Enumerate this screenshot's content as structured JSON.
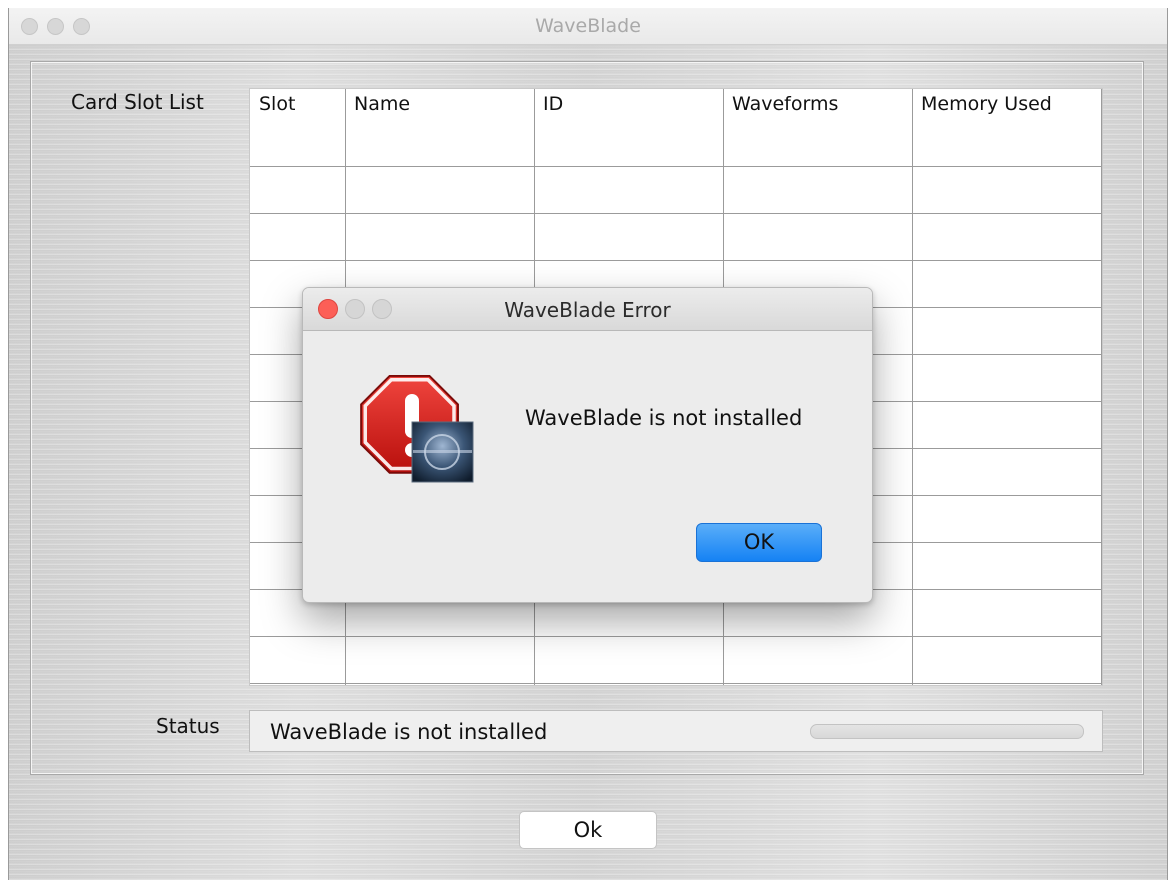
{
  "window": {
    "title": "WaveBlade"
  },
  "labels": {
    "card_slot_list": "Card Slot List",
    "status": "Status"
  },
  "table": {
    "columns": [
      "Slot",
      "Name",
      "ID",
      "Waveforms",
      "Memory Used"
    ],
    "rows": []
  },
  "status": {
    "text": "WaveBlade is not installed"
  },
  "buttons": {
    "ok": "Ok"
  },
  "dialog": {
    "title": "WaveBlade Error",
    "message": "WaveBlade is not installed",
    "ok_label": "OK",
    "icon": "stop-error-icon",
    "colors": {
      "close": "#fc5f57",
      "accent": "#1a84f5",
      "stop": "#d8231f"
    }
  }
}
